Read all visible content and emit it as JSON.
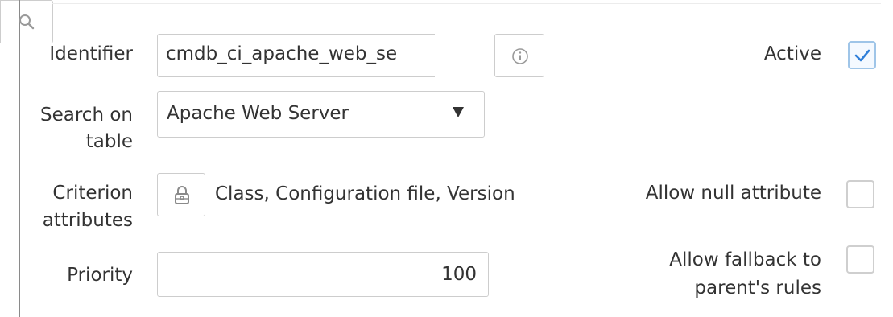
{
  "form": {
    "identifier": {
      "label": "Identifier",
      "value": "cmdb_ci_apache_web_se",
      "search_icon": "search-icon",
      "info_icon": "info-icon"
    },
    "active": {
      "label": "Active",
      "checked": true
    },
    "search_on_table": {
      "label_line1": "Search on",
      "label_line2": "table",
      "selected": "Apache Web Server",
      "arrow_icon": "triangle-down-icon"
    },
    "criterion_attributes": {
      "label_line1": "Criterion",
      "label_line2": "attributes",
      "lock_icon": "lock-icon",
      "value": "Class, Configuration file, Version"
    },
    "allow_null_attribute": {
      "label": "Allow null attribute",
      "checked": false
    },
    "priority": {
      "label": "Priority",
      "value": "100"
    },
    "allow_fallback": {
      "label_line1": "Allow fallback to",
      "label_line2": "parent's rules",
      "checked": false
    },
    "colors": {
      "text": "#333333",
      "field_border": "#cdcdcd",
      "checkbox_border": "#cfcfcf",
      "check_accent": "#2f7fd9"
    }
  }
}
